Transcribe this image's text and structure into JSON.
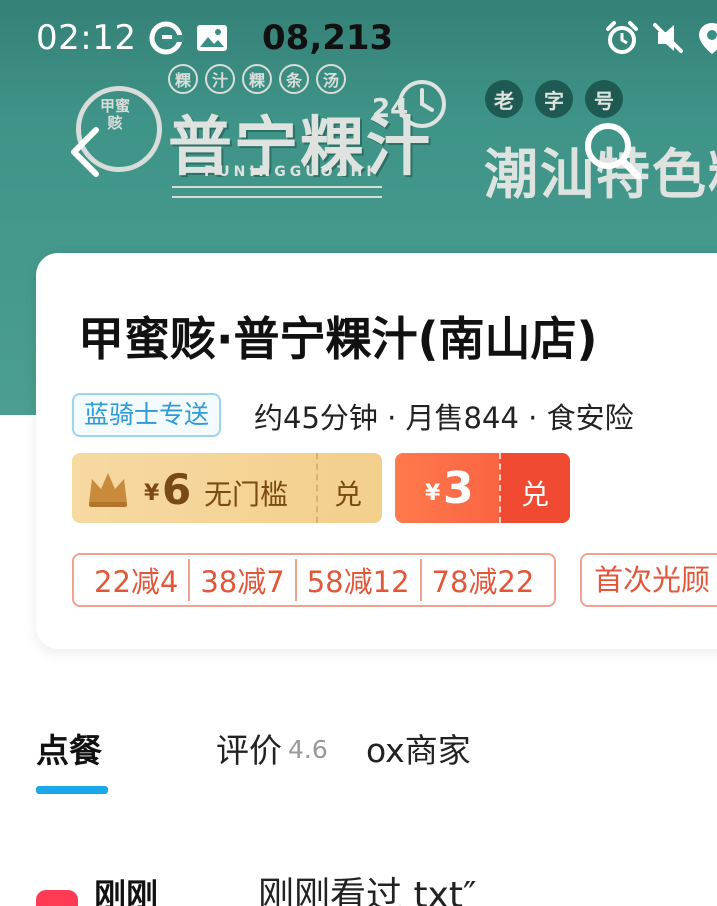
{
  "status_bar": {
    "time": "02:12",
    "steps": "08,213",
    "icons": [
      "app-notification-icon",
      "image-icon",
      "alarm-icon",
      "mute-icon",
      "location-icon"
    ]
  },
  "banner": {
    "small_chips": [
      "粿",
      "汁",
      "粿",
      "条",
      "汤"
    ],
    "seal_text": "甲蜜赅",
    "brand_name": "普宁粿汁",
    "brand_pinyin": "PUNINGGUOZHI",
    "hours_number": "24",
    "big_chips": [
      "老",
      "字",
      "号"
    ],
    "slogan": "潮汕特色粿"
  },
  "store": {
    "name": "甲蜜赅·普宁粿汁(南山店)",
    "delivery_badge": "蓝骑士专送",
    "meta": "约45分钟 · 月售844 · 食安险",
    "coupon_member": {
      "currency": "¥",
      "amount": "6",
      "description": "无门槛",
      "action": "兑"
    },
    "coupon_red": {
      "currency": "¥",
      "amount": "3",
      "action": "兑"
    },
    "discounts": [
      "22减4",
      "38减7",
      "58减12",
      "78减22"
    ],
    "first_visit": "首次光顾"
  },
  "tabs": {
    "order": "点餐",
    "review": "评价",
    "review_score": "4.6",
    "merchant": "ox商家"
  },
  "bottom": {
    "side_label": "刚刚",
    "section_title": "刚刚看过   txt″"
  },
  "colors": {
    "banner_teal": "#43978b",
    "accent_blue": "#1ba8ea",
    "discount_red": "#e4563a",
    "coupon_gold": "#f3cf8c"
  }
}
